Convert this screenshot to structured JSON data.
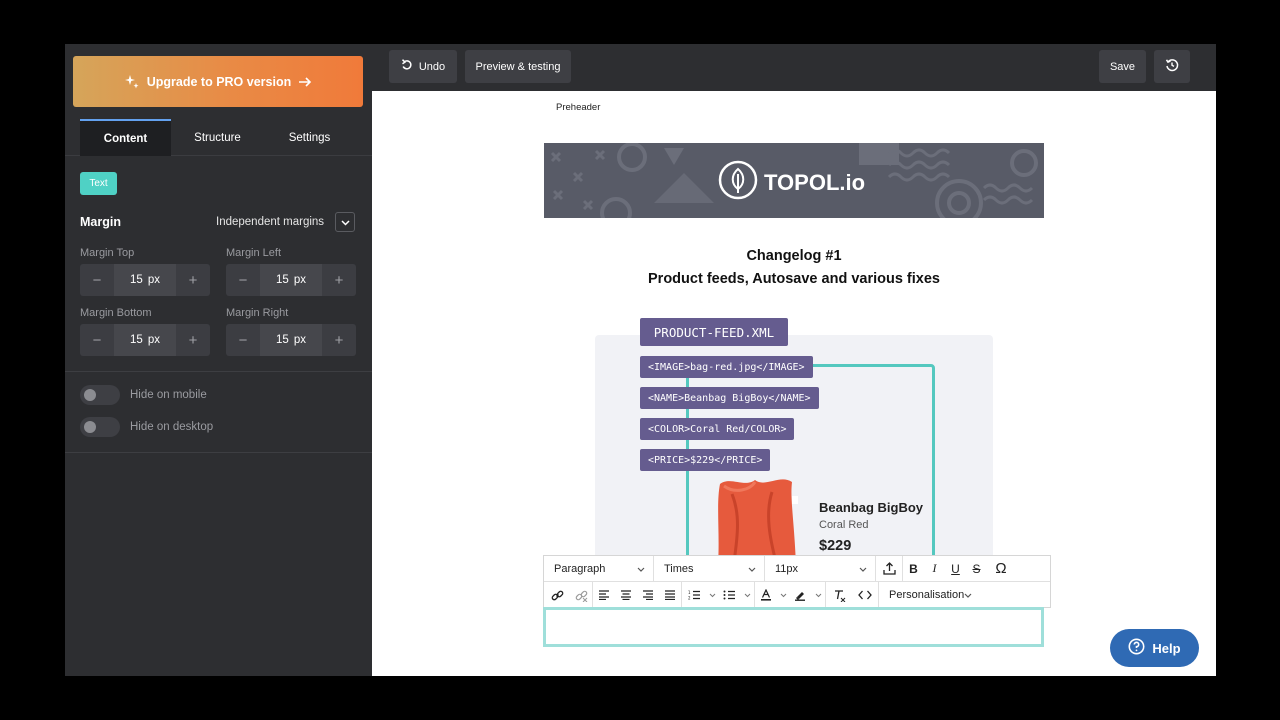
{
  "sidebar": {
    "upgrade_label": "Upgrade to PRO version",
    "tabs": [
      {
        "label": "Content",
        "active": true
      },
      {
        "label": "Structure",
        "active": false
      },
      {
        "label": "Settings",
        "active": false
      }
    ],
    "block_tag": "Text",
    "margin": {
      "title": "Margin",
      "mode_label": "Independent margins",
      "fields": [
        {
          "label": "Margin Top",
          "value": "15",
          "unit": "px"
        },
        {
          "label": "Margin Left",
          "value": "15",
          "unit": "px"
        },
        {
          "label": "Margin Bottom",
          "value": "15",
          "unit": "px"
        },
        {
          "label": "Margin Right",
          "value": "15",
          "unit": "px"
        }
      ]
    },
    "toggles": [
      {
        "label": "Hide on mobile",
        "on": false
      },
      {
        "label": "Hide on desktop",
        "on": false
      }
    ]
  },
  "topbar": {
    "undo_label": "Undo",
    "preview_label": "Preview & testing",
    "save_label": "Save"
  },
  "email": {
    "preheader": "Preheader",
    "banner_brand": "TOPOL.io",
    "heading_line1": "Changelog #1",
    "heading_line2": "Product feeds, Autosave and various fixes",
    "feed": {
      "title": "PRODUCT-FEED.XML",
      "tags": [
        "<IMAGE>bag-red.jpg</IMAGE>",
        "<NAME>Beanbag BigBoy</NAME>",
        "<COLOR>Coral Red/COLOR>",
        "<PRICE>$229</PRICE>"
      ],
      "product_name": "Beanbag BigBoy",
      "product_color": "Coral Red",
      "product_price": "$229"
    }
  },
  "editor_toolbar": {
    "block_format": "Paragraph",
    "font_family": "Times",
    "font_size": "11px",
    "personalisation": "Personalisation"
  },
  "help_label": "Help",
  "colors": {
    "accent_teal": "#4fd1c5",
    "feed_purple": "#655c8f",
    "help_blue": "#2f6ab4",
    "upgrade_orange": "#f07a3a"
  }
}
